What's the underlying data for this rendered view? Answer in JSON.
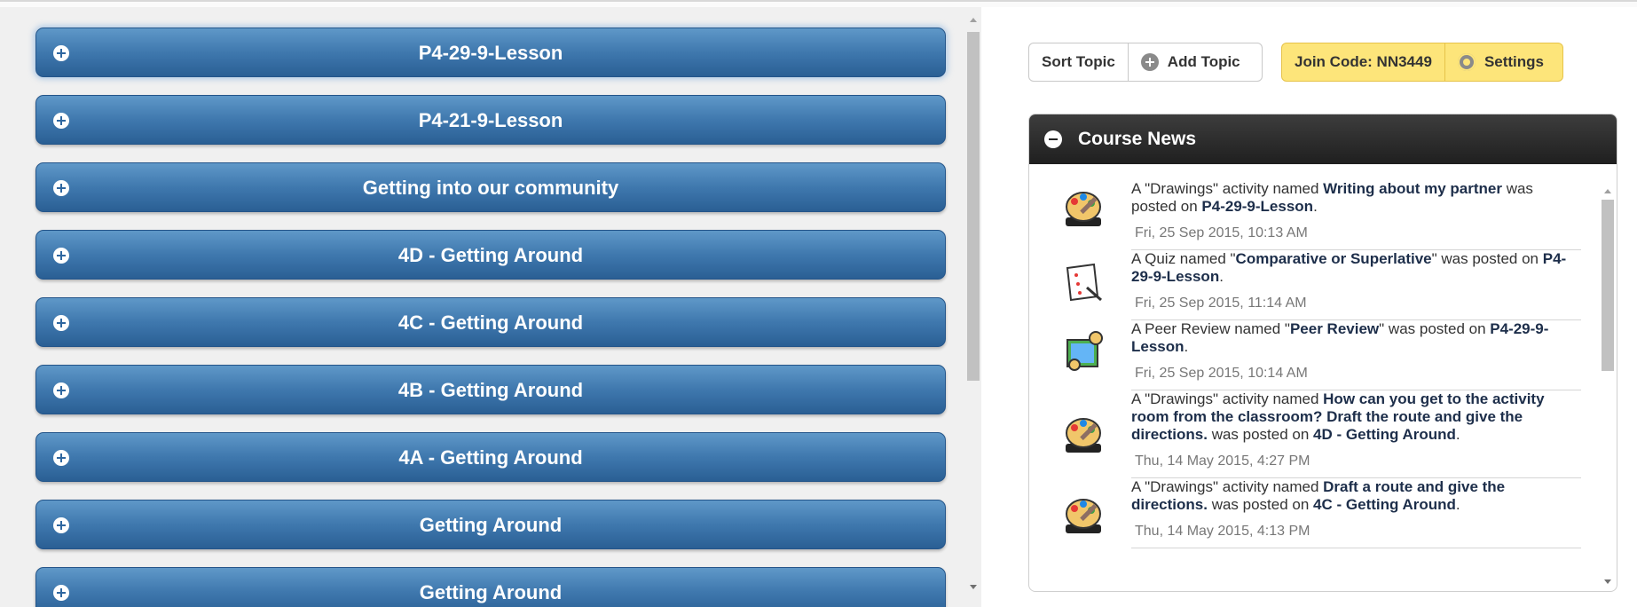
{
  "topics": [
    {
      "title": "P4-29-9-Lesson"
    },
    {
      "title": "P4-21-9-Lesson"
    },
    {
      "title": "Getting into our community"
    },
    {
      "title": "4D - Getting Around"
    },
    {
      "title": "4C - Getting Around"
    },
    {
      "title": "4B - Getting Around"
    },
    {
      "title": "4A - Getting Around"
    },
    {
      "title": "Getting Around"
    },
    {
      "title": "Getting Around"
    }
  ],
  "toolbar": {
    "sort_topic": "Sort Topic",
    "add_topic": "Add Topic",
    "join_code": "Join Code: NN3449",
    "settings": "Settings"
  },
  "news": {
    "title": "Course News",
    "items": [
      {
        "icon": "drawings-icon",
        "parts": [
          "A \"Drawings\" activity named ",
          "Writing about my partner",
          " was posted on ",
          "P4-29-9-Lesson",
          "."
        ],
        "date": "Fri, 25 Sep 2015, 10:13 AM"
      },
      {
        "icon": "quiz-icon",
        "parts": [
          "A Quiz named \"",
          "Comparative or Superlative",
          "\" was posted on ",
          "P4-29-9-Lesson",
          "."
        ],
        "date": "Fri, 25 Sep 2015, 11:14 AM"
      },
      {
        "icon": "peer-review-icon",
        "parts": [
          "A Peer Review named \"",
          "Peer Review",
          "\" was posted on ",
          "P4-29-9-Lesson",
          "."
        ],
        "date": "Fri, 25 Sep 2015, 10:14 AM"
      },
      {
        "icon": "drawings-icon",
        "parts": [
          "A \"Drawings\" activity named ",
          "How can you get to the activity room from the classroom? Draft the route and give the directions.",
          " was posted on ",
          "4D - Getting Around",
          "."
        ],
        "date": "Thu, 14 May 2015, 4:27 PM"
      },
      {
        "icon": "drawings-icon",
        "parts": [
          "A \"Drawings\" activity named ",
          "Draft a route and give the directions.",
          " was posted on ",
          "4C - Getting Around",
          "."
        ],
        "date": "Thu, 14 May 2015, 4:13 PM"
      }
    ]
  },
  "colors": {
    "topic_bar": "#3f78ae",
    "join_code_bg": "#fde57a",
    "news_header": "#2a2a2a"
  }
}
